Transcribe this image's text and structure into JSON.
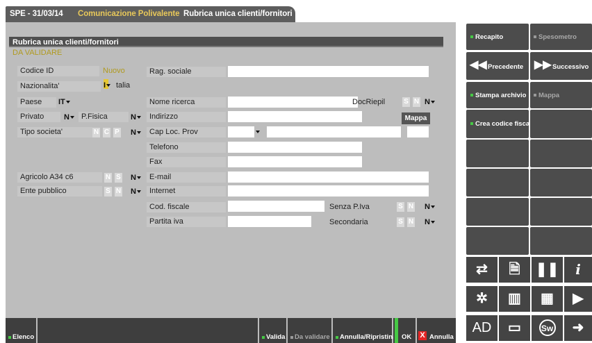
{
  "tab": {
    "subtitle": "SPE - 31/03/14",
    "app": "Comunicazione Polivalente",
    "module": "Rubrica unica clienti/fornitori"
  },
  "form": {
    "panel_title": "Rubrica unica clienti/fornitori",
    "status": "DA VALIDARE",
    "codice_id": {
      "label": "Codice ID",
      "value": "Nuovo"
    },
    "nazionalita": {
      "label": "Nazionalita'",
      "code": "I",
      "text": "talia"
    },
    "paese": {
      "label": "Paese",
      "value": "IT"
    },
    "privato": {
      "label": "Privato",
      "value": "N",
      "pfisica_label": "P.Fisica",
      "pfisica_value": "N"
    },
    "tipo_societa": {
      "label": "Tipo societa'",
      "options": [
        "N",
        "C",
        "P"
      ],
      "value": "N"
    },
    "agricolo": {
      "label": "Agricolo A34 c6",
      "options": [
        "N",
        "S"
      ],
      "value": "N"
    },
    "ente_pubblico": {
      "label": "Ente pubblico",
      "options": [
        "S",
        "N"
      ],
      "value": "N"
    },
    "rag_sociale": {
      "label": "Rag. sociale",
      "value": ""
    },
    "nome_ricerca": {
      "label": "Nome ricerca",
      "value": ""
    },
    "doc_riepil": {
      "label": "DocRiepil",
      "options": [
        "S",
        "N"
      ],
      "value": "N"
    },
    "indirizzo": {
      "label": "Indirizzo",
      "value": ""
    },
    "mappa_tooltip": "Mappa",
    "cap_loc_prov": {
      "label": "Cap Loc. Prov",
      "value": ""
    },
    "telefono": {
      "label": "Telefono",
      "value": ""
    },
    "fax": {
      "label": "Fax",
      "value": ""
    },
    "email": {
      "label": "E-mail",
      "value": ""
    },
    "internet": {
      "label": "Internet",
      "value": ""
    },
    "cod_fiscale": {
      "label": "Cod. fiscale",
      "value": ""
    },
    "senza_piva": {
      "label": "Senza P.Iva",
      "options": [
        "S",
        "N"
      ],
      "value": "N"
    },
    "partita_iva": {
      "label": "Partita iva",
      "value": ""
    },
    "secondaria": {
      "label": "Secondaria",
      "options": [
        "S",
        "N"
      ],
      "value": "N"
    }
  },
  "bottom": {
    "elenco": "Elenco",
    "valida": "Valida",
    "da_validare": "Da validare",
    "annulla_ripristina": "Annulla/Ripristina",
    "ok": "OK",
    "annulla": "Annulla",
    "annulla_icon": "X"
  },
  "sidebar": {
    "recapito": "Recapito",
    "spesometro": "Spesometro",
    "precedente": "Precedente",
    "successivo": "Successivo",
    "stampa_archivio": "Stampa archivio",
    "mappa": "Mappa",
    "crea_codice_fiscale": "Crea codice fiscale",
    "icons": [
      "transfer-icon",
      "document-search-icon",
      "pause-icon",
      "info-icon",
      "snowflake-icon",
      "barcode-icon",
      "calculator-icon",
      "play-icon",
      "ad-text",
      "card-icon",
      "sw-icon",
      "arrow-right-icon"
    ],
    "ad_label": "AD",
    "sw_label": "Sw"
  },
  "colors": {
    "accent_green": "#46c845",
    "status_gold": "#b09a1f",
    "cursor_yellow": "#e7c832",
    "cancel_red": "#e32424"
  }
}
